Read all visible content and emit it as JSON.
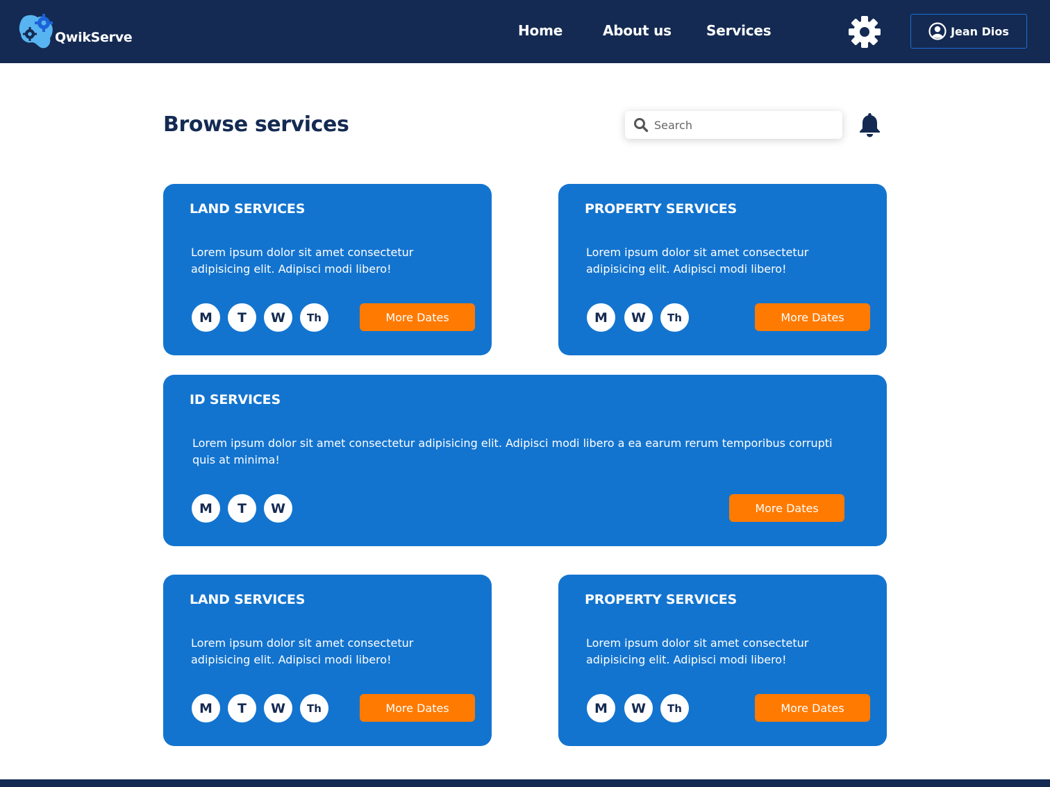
{
  "app": {
    "name": "QwikServe"
  },
  "nav": {
    "links": [
      {
        "label": "Home"
      },
      {
        "label": "About us"
      },
      {
        "label": "Services"
      }
    ],
    "user_name": "Jean Dios"
  },
  "main": {
    "title": "Browse services",
    "search_placeholder": "Search"
  },
  "colors": {
    "navbar": "#142a52",
    "card": "#1374cf",
    "button": "#ff7a00"
  },
  "cards": [
    {
      "title": "LAND SERVICES",
      "description": "Lorem ipsum dolor sit amet consectetur adipisicing elit. Adipisci modi libero!",
      "days": [
        "M",
        "T",
        "W",
        "Th"
      ],
      "button": "More Dates"
    },
    {
      "title": "PROPERTY SERVICES",
      "description": "Lorem ipsum dolor sit amet consectetur adipisicing elit. Adipisci modi libero!",
      "days": [
        "M",
        "W",
        "Th"
      ],
      "button": "More Dates"
    },
    {
      "title": "ID SERVICES",
      "description": "Lorem ipsum dolor sit amet consectetur adipisicing elit. Adipisci modi libero a ea earum rerum temporibus corrupti quis at minima!",
      "days": [
        "M",
        "T",
        "W"
      ],
      "button": "More Dates"
    },
    {
      "title": "LAND SERVICES",
      "description": "Lorem ipsum dolor sit amet consectetur adipisicing elit. Adipisci modi libero!",
      "days": [
        "M",
        "T",
        "W",
        "Th"
      ],
      "button": "More Dates"
    },
    {
      "title": "PROPERTY SERVICES",
      "description": "Lorem ipsum dolor sit amet consectetur adipisicing elit. Adipisci modi libero!",
      "days": [
        "M",
        "W",
        "Th"
      ],
      "button": "More Dates"
    }
  ]
}
